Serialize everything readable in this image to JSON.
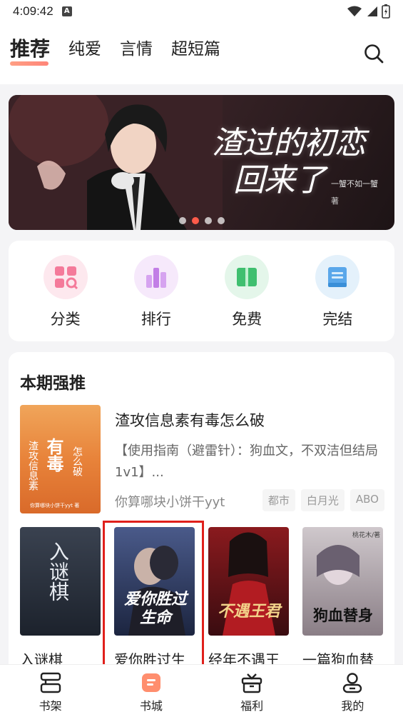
{
  "status_bar": {
    "time": "4:09:42",
    "notification_icon": "A"
  },
  "top_tabs": [
    {
      "label": "推荐",
      "active": true
    },
    {
      "label": "纯爱",
      "active": false
    },
    {
      "label": "言情",
      "active": false
    },
    {
      "label": "超短篇",
      "active": false
    }
  ],
  "banner": {
    "title_line1": "渣过的初恋",
    "title_line2": "回来了",
    "author": "一蟹不如一蟹",
    "author_suffix": "著",
    "dot_count": 4,
    "active_dot": 1
  },
  "shortcuts": [
    {
      "label": "分类",
      "icon": "category-icon",
      "bg": "#fde8ee",
      "color": "#f47a9a"
    },
    {
      "label": "排行",
      "icon": "ranking-icon",
      "bg": "#f6e9fb",
      "color": "#c27ee6"
    },
    {
      "label": "免费",
      "icon": "free-book-icon",
      "bg": "#e4f6ea",
      "color": "#3fbf6f"
    },
    {
      "label": "完结",
      "icon": "completed-icon",
      "bg": "#e4f1fb",
      "color": "#5aa7ea"
    }
  ],
  "recommend": {
    "heading": "本期强推",
    "featured": {
      "title": "渣攻信息素有毒怎么破",
      "description": "【使用指南（避雷针）：狗血文，不双洁但结局1v1】...",
      "author": "你算哪块小饼干yyt",
      "tags": [
        "都市",
        "白月光",
        "ABO"
      ],
      "cover_text_main": "有毒",
      "cover_text_left": "渣攻信息素",
      "cover_text_right": "怎么破",
      "cover_footer": "你算哪块小饼干yyt 著"
    },
    "books": [
      {
        "title": "入谜棋",
        "cover_text": "入谜棋"
      },
      {
        "title": "爱你胜过生",
        "cover_text": "爱你胜过生命"
      },
      {
        "title": "经年不遇王",
        "cover_text": "不遇王君"
      },
      {
        "title": "一篇狗血替",
        "cover_text": "狗血替身"
      }
    ],
    "book4_cover_author": "桃花木/著"
  },
  "bottom_tabs": [
    {
      "label": "书架",
      "icon": "bookshelf-icon",
      "active": false
    },
    {
      "label": "书城",
      "icon": "bookstore-icon",
      "active": true
    },
    {
      "label": "福利",
      "icon": "gift-icon",
      "active": false
    },
    {
      "label": "我的",
      "icon": "profile-icon",
      "active": false
    }
  ],
  "colors": {
    "accent": "#ff6f61",
    "highlight_border": "#e0201b",
    "background": "#f4f4f6"
  }
}
